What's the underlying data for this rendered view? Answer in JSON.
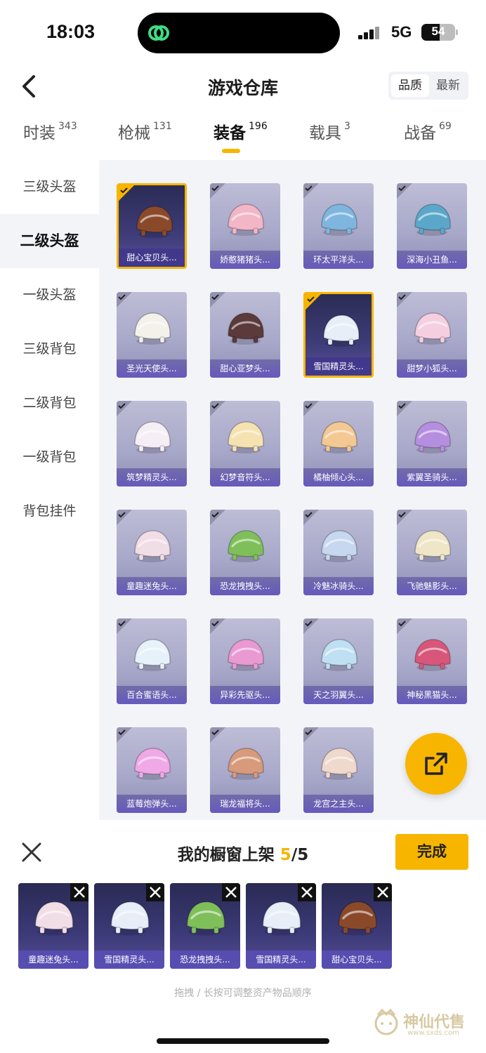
{
  "status_bar": {
    "time": "18:03",
    "network": "5G",
    "battery": "54",
    "battery_level": 0.54
  },
  "header": {
    "title": "游戏仓库",
    "sort": [
      "品质",
      "最新"
    ]
  },
  "tabs": [
    {
      "label": "时装",
      "count": "343"
    },
    {
      "label": "枪械",
      "count": "131"
    },
    {
      "label": "装备",
      "count": "196"
    },
    {
      "label": "载具",
      "count": "3"
    },
    {
      "label": "战备",
      "count": "69"
    }
  ],
  "sidebar": [
    "三级头盔",
    "二级头盔",
    "一级头盔",
    "三级背包",
    "二级背包",
    "一级背包",
    "背包挂件"
  ],
  "items": [
    {
      "name": "甜心宝贝头...",
      "selected": true,
      "color": "#8a4a2a"
    },
    {
      "name": "娇憨猪猪头...",
      "selected": false,
      "color": "#f2b6c6"
    },
    {
      "name": "环太平洋头...",
      "selected": false,
      "color": "#7fb6e0"
    },
    {
      "name": "深海小丑鱼...",
      "selected": false,
      "color": "#5aa7c9"
    },
    {
      "name": "圣光天使头...",
      "selected": false,
      "color": "#f4f1ea"
    },
    {
      "name": "甜心亚梦头...",
      "selected": false,
      "color": "#5a3a3a"
    },
    {
      "name": "雪国精灵头...",
      "selected": true,
      "color": "#e8eef8"
    },
    {
      "name": "甜梦小狐头...",
      "selected": false,
      "color": "#f5cfe0"
    },
    {
      "name": "筑梦精灵头...",
      "selected": false,
      "color": "#f6eef5"
    },
    {
      "name": "幻梦音符头...",
      "selected": false,
      "color": "#f5e2b0"
    },
    {
      "name": "橘柚倾心头...",
      "selected": false,
      "color": "#f3c892"
    },
    {
      "name": "紫翼圣骑头...",
      "selected": false,
      "color": "#b58ee0"
    },
    {
      "name": "童趣迷兔头...",
      "selected": false,
      "color": "#f1dde6"
    },
    {
      "name": "恐龙拽拽头...",
      "selected": false,
      "color": "#7fbf5a"
    },
    {
      "name": "冷魅冰骑头...",
      "selected": false,
      "color": "#c6d7ef"
    },
    {
      "name": "飞驰魅影头...",
      "selected": false,
      "color": "#efe6c8"
    },
    {
      "name": "百合蜜语头...",
      "selected": false,
      "color": "#e7f1f9"
    },
    {
      "name": "异彩先驱头...",
      "selected": false,
      "color": "#e99ad2"
    },
    {
      "name": "天之羽翼头...",
      "selected": false,
      "color": "#bfe0f2"
    },
    {
      "name": "神秘黑猫头...",
      "selected": false,
      "color": "#d8567a"
    },
    {
      "name": "蓝莓炮弹头...",
      "selected": false,
      "color": "#f1a8e6"
    },
    {
      "name": "瑞龙福将头...",
      "selected": false,
      "color": "#d79a7a"
    },
    {
      "name": "龙宫之主头...",
      "selected": false,
      "color": "#efd8cc"
    }
  ],
  "shelf": {
    "title": "我的橱窗上架",
    "count": "5",
    "total": "/5",
    "done": "完成",
    "hint": "拖拽 / 长按可调整资产物品顺序"
  },
  "shelf_items": [
    {
      "name": "童趣迷兔头...",
      "color": "#f1dde6"
    },
    {
      "name": "雪国精灵头...",
      "color": "#e8eef8"
    },
    {
      "name": "恐龙拽拽头...",
      "color": "#7fbf5a"
    },
    {
      "name": "雪国精灵头...",
      "color": "#e8eef8"
    },
    {
      "name": "甜心宝贝头...",
      "color": "#8a4a2a"
    }
  ],
  "watermark": {
    "text": "神仙代售",
    "url": "www.sxds.com"
  }
}
